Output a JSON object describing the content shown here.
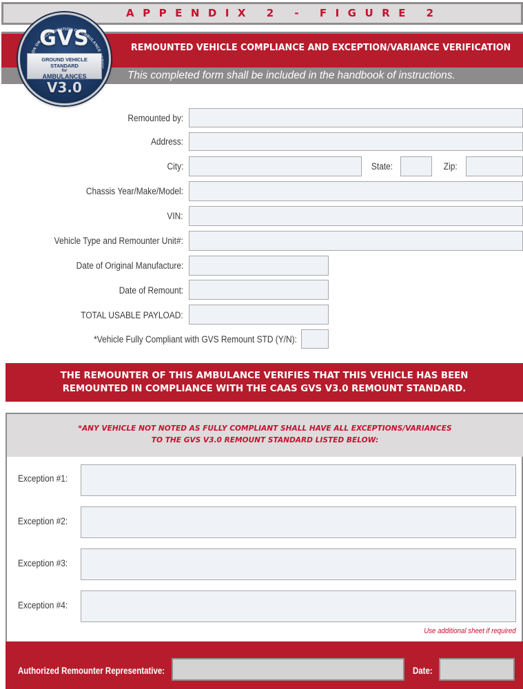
{
  "header": {
    "appendix": "APPENDIX 2 - FIGURE 2",
    "title": "REMOUNTED VEHICLE COMPLIANCE AND EXCEPTION/VARIANCE VERIFICATION",
    "subtitle": "This completed form shall be included in the handbook of instructions."
  },
  "logo": {
    "gvs": "GVS",
    "ring_text": "COMMISSION ON ACCREDITATION OF AMBULANCE SERVICES",
    "line1": "GROUND VEHICLE STANDARD",
    "line2": "for",
    "line3": "AMBULANCES",
    "version": "V3.0"
  },
  "form": {
    "remounted_by": {
      "label": "Remounted by:",
      "value": ""
    },
    "address": {
      "label": "Address:",
      "value": ""
    },
    "city": {
      "label": "City:",
      "value": ""
    },
    "state": {
      "label": "State:",
      "value": ""
    },
    "zip": {
      "label": "Zip:",
      "value": ""
    },
    "chassis": {
      "label": "Chassis Year/Make/Model:",
      "value": ""
    },
    "vin": {
      "label": "VIN:",
      "value": ""
    },
    "vehicle_type": {
      "label": "Vehicle Type and Remounter Unit#:",
      "value": ""
    },
    "date_original": {
      "label": "Date of Original Manufacture:",
      "value": ""
    },
    "date_remount": {
      "label": "Date of Remount:",
      "value": ""
    },
    "payload": {
      "label": "TOTAL USABLE PAYLOAD:",
      "value": ""
    },
    "compliant": {
      "label": "*Vehicle Fully Compliant with GVS Remount STD (Y/N):",
      "value": ""
    }
  },
  "verification": {
    "line1": "THE REMOUNTER OF THIS AMBULANCE VERIFIES THAT THIS VEHICLE HAS BEEN",
    "line2": "REMOUNTED IN COMPLIANCE WITH THE CAAS GVS V3.0 REMOUNT STANDARD."
  },
  "exceptions": {
    "note_line1": "*ANY VEHICLE NOT NOTED AS FULLY COMPLIANT SHALL HAVE ALL EXCEPTIONS/VARIANCES",
    "note_line2": "TO THE GVS V3.0 REMOUNT STANDARD LISTED BELOW:",
    "items": [
      {
        "label": "Exception #1:",
        "value": ""
      },
      {
        "label": "Exception #2:",
        "value": ""
      },
      {
        "label": "Exception #3:",
        "value": ""
      },
      {
        "label": "Exception #4:",
        "value": ""
      }
    ],
    "additional_note": "Use additional sheet if required"
  },
  "signature": {
    "rep_label": "Authorized Remounter Representative:",
    "rep_value": "",
    "date_label": "Date:",
    "date_value": ""
  },
  "colors": {
    "brand_red": "#b71c2c",
    "banner_gray": "#dddbdc",
    "field_fill": "#eff2f6"
  }
}
